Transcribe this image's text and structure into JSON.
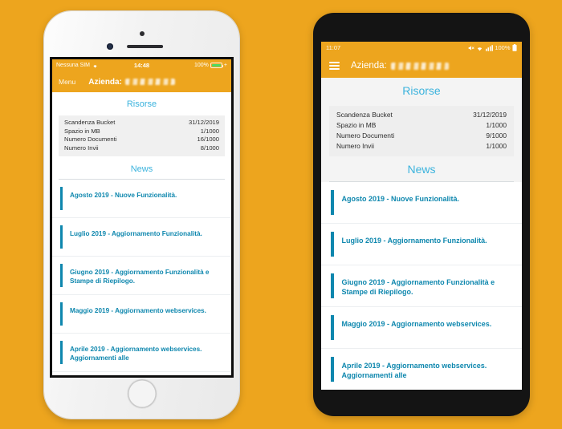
{
  "theme": {
    "page_background": "#EDA51E",
    "app_bar": "#EDA51E",
    "heading_accent": "#3BB3DD",
    "news_accent": "#0E87AE",
    "battery_green": "#4CD964"
  },
  "iphone": {
    "device": "white-iphone",
    "status_bar": {
      "carrier": "Nessuna SIM",
      "wifi_icon": "wifi-icon",
      "time": "14:48",
      "battery_percent": "100%",
      "charging_symbol": "+"
    },
    "nav_bar": {
      "menu_label": "Menu",
      "title_prefix": "Azienda:",
      "company_name_redacted": true
    },
    "resources": {
      "heading": "Risorse",
      "rows": [
        {
          "label": "Scandenza Bucket",
          "value": "31/12/2019"
        },
        {
          "label": "Spazio in MB",
          "value": "1/1000"
        },
        {
          "label": "Numero Documenti",
          "value": "16/1000"
        },
        {
          "label": "Numero Invii",
          "value": "8/1000"
        }
      ]
    },
    "news": {
      "heading": "News",
      "items": [
        {
          "text": "Agosto 2019 - Nuove Funzionalità."
        },
        {
          "text": "Luglio 2019 - Aggiornamento Funzionalità."
        },
        {
          "text": "Giugno 2019 - Aggiornamento Funzionalità e Stampe di Riepilogo."
        },
        {
          "text": "Maggio 2019 - Aggiornamento webservices."
        },
        {
          "text": "Aprile 2019 - Aggiornamento webservices. Aggiornamenti alle"
        }
      ]
    },
    "home_button": "home-button"
  },
  "android": {
    "device": "black-android-phone",
    "status_bar": {
      "time": "11:07",
      "mute_icon": "mute-icon",
      "wifi_icon": "wifi-icon",
      "signal_icon": "signal-bars-icon",
      "battery_percent": "100%",
      "battery_icon": "battery-icon"
    },
    "nav_bar": {
      "menu_icon": "hamburger-menu-icon",
      "title_prefix": "Azienda:",
      "company_name_redacted": true
    },
    "resources": {
      "heading": "Risorse",
      "rows": [
        {
          "label": "Scandenza Bucket",
          "value": "31/12/2019"
        },
        {
          "label": "Spazio in MB",
          "value": "1/1000"
        },
        {
          "label": "Numero Documenti",
          "value": "9/1000"
        },
        {
          "label": "Numero Invii",
          "value": "1/1000"
        }
      ]
    },
    "news": {
      "heading": "News",
      "items": [
        {
          "text": "Agosto 2019 - Nuove Funzionalità."
        },
        {
          "text": "Luglio 2019 - Aggiornamento Funzionalità."
        },
        {
          "text": "Giugno 2019 - Aggiornamento Funzionalità e Stampe di Riepilogo."
        },
        {
          "text": "Maggio 2019 - Aggiornamento webservices."
        },
        {
          "text": "Aprile 2019 - Aggiornamento webservices. Aggiornamenti alle"
        }
      ]
    }
  }
}
